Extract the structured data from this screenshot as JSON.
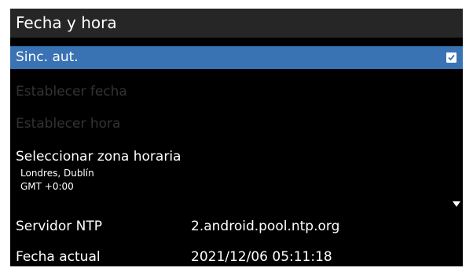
{
  "title": "Fecha y hora",
  "items": {
    "auto_sync": {
      "label": "Sinc. aut.",
      "checked": true
    },
    "set_date": {
      "label": "Establecer fecha"
    },
    "set_time": {
      "label": "Establecer hora"
    },
    "timezone": {
      "label": "Seleccionar zona horaria",
      "city": "Londres, Dublín",
      "offset": "GMT +0:00"
    },
    "ntp_server": {
      "label": "Servidor NTP",
      "value": "2.android.pool.ntp.org"
    },
    "current_date": {
      "label": "Fecha actual",
      "value": "2021/12/06 05:11:18"
    }
  },
  "icons": {
    "checkbox": "checkbox-checked-icon",
    "scroll": "scroll-down-arrow-icon"
  },
  "colors": {
    "selected": "#3a73b4",
    "title_bar": "#262626",
    "disabled_text": "#333333"
  }
}
